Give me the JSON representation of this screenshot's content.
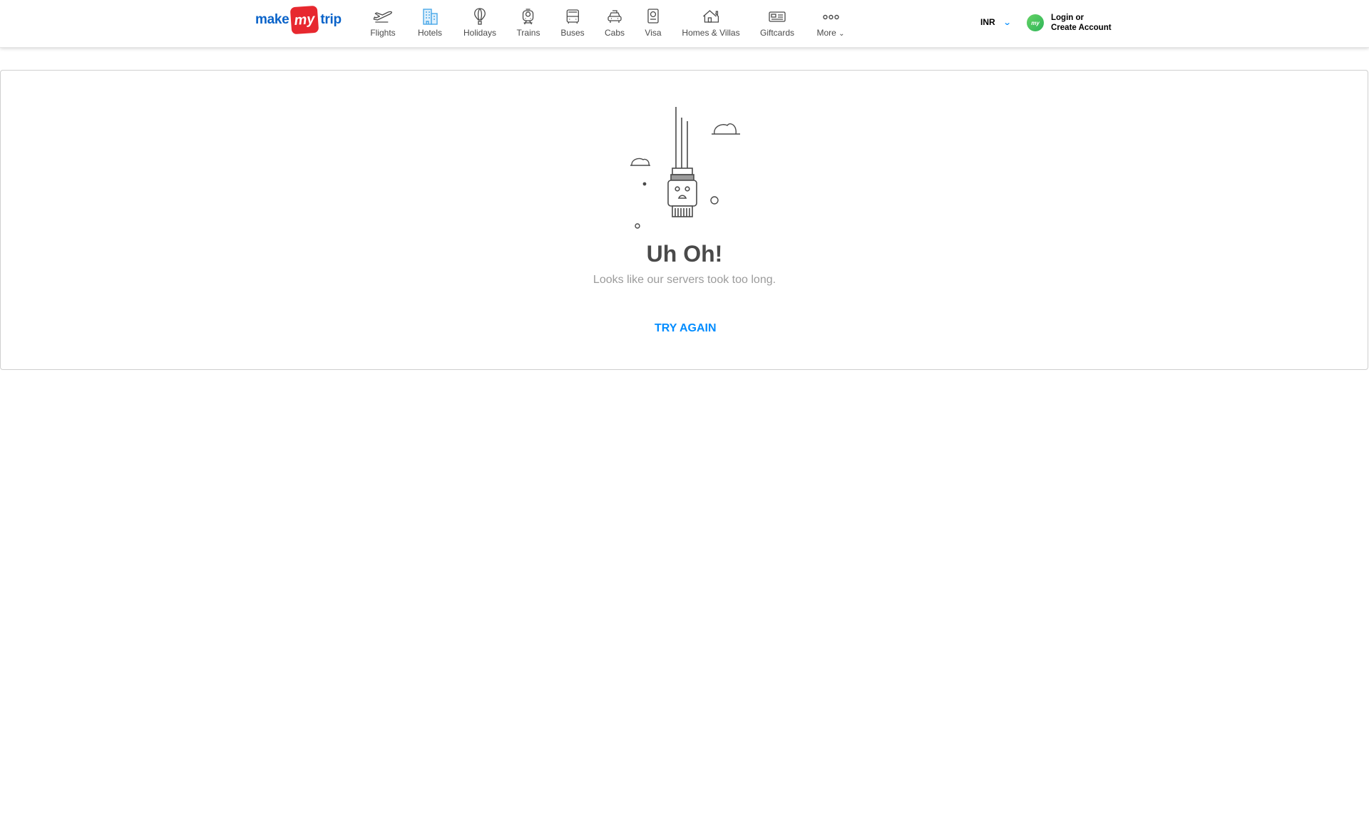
{
  "brand": {
    "part1": "make",
    "part2": "my",
    "part3": "trip"
  },
  "nav": [
    {
      "label": "Flights",
      "icon": "flight-icon"
    },
    {
      "label": "Hotels",
      "icon": "hotel-icon"
    },
    {
      "label": "Holidays",
      "icon": "holiday-balloon-icon"
    },
    {
      "label": "Trains",
      "icon": "train-icon"
    },
    {
      "label": "Buses",
      "icon": "bus-icon"
    },
    {
      "label": "Cabs",
      "icon": "cab-icon"
    },
    {
      "label": "Visa",
      "icon": "visa-icon"
    },
    {
      "label": "Homes & Villas",
      "icon": "home-villa-icon"
    },
    {
      "label": "Giftcards",
      "icon": "giftcard-icon"
    },
    {
      "label": "More",
      "icon": "more-dots-icon"
    }
  ],
  "currency": {
    "value": "INR"
  },
  "account": {
    "line1": "Login or",
    "line2": "Create Account",
    "avatar_text": "my"
  },
  "error": {
    "title": "Uh Oh!",
    "message": "Looks like our servers took too long.",
    "action": "TRY AGAIN"
  },
  "colors": {
    "brand_blue": "#0a63c9",
    "brand_red": "#e7282f",
    "link_blue": "#008cff",
    "hotel_icon": "#4aa8e8"
  }
}
